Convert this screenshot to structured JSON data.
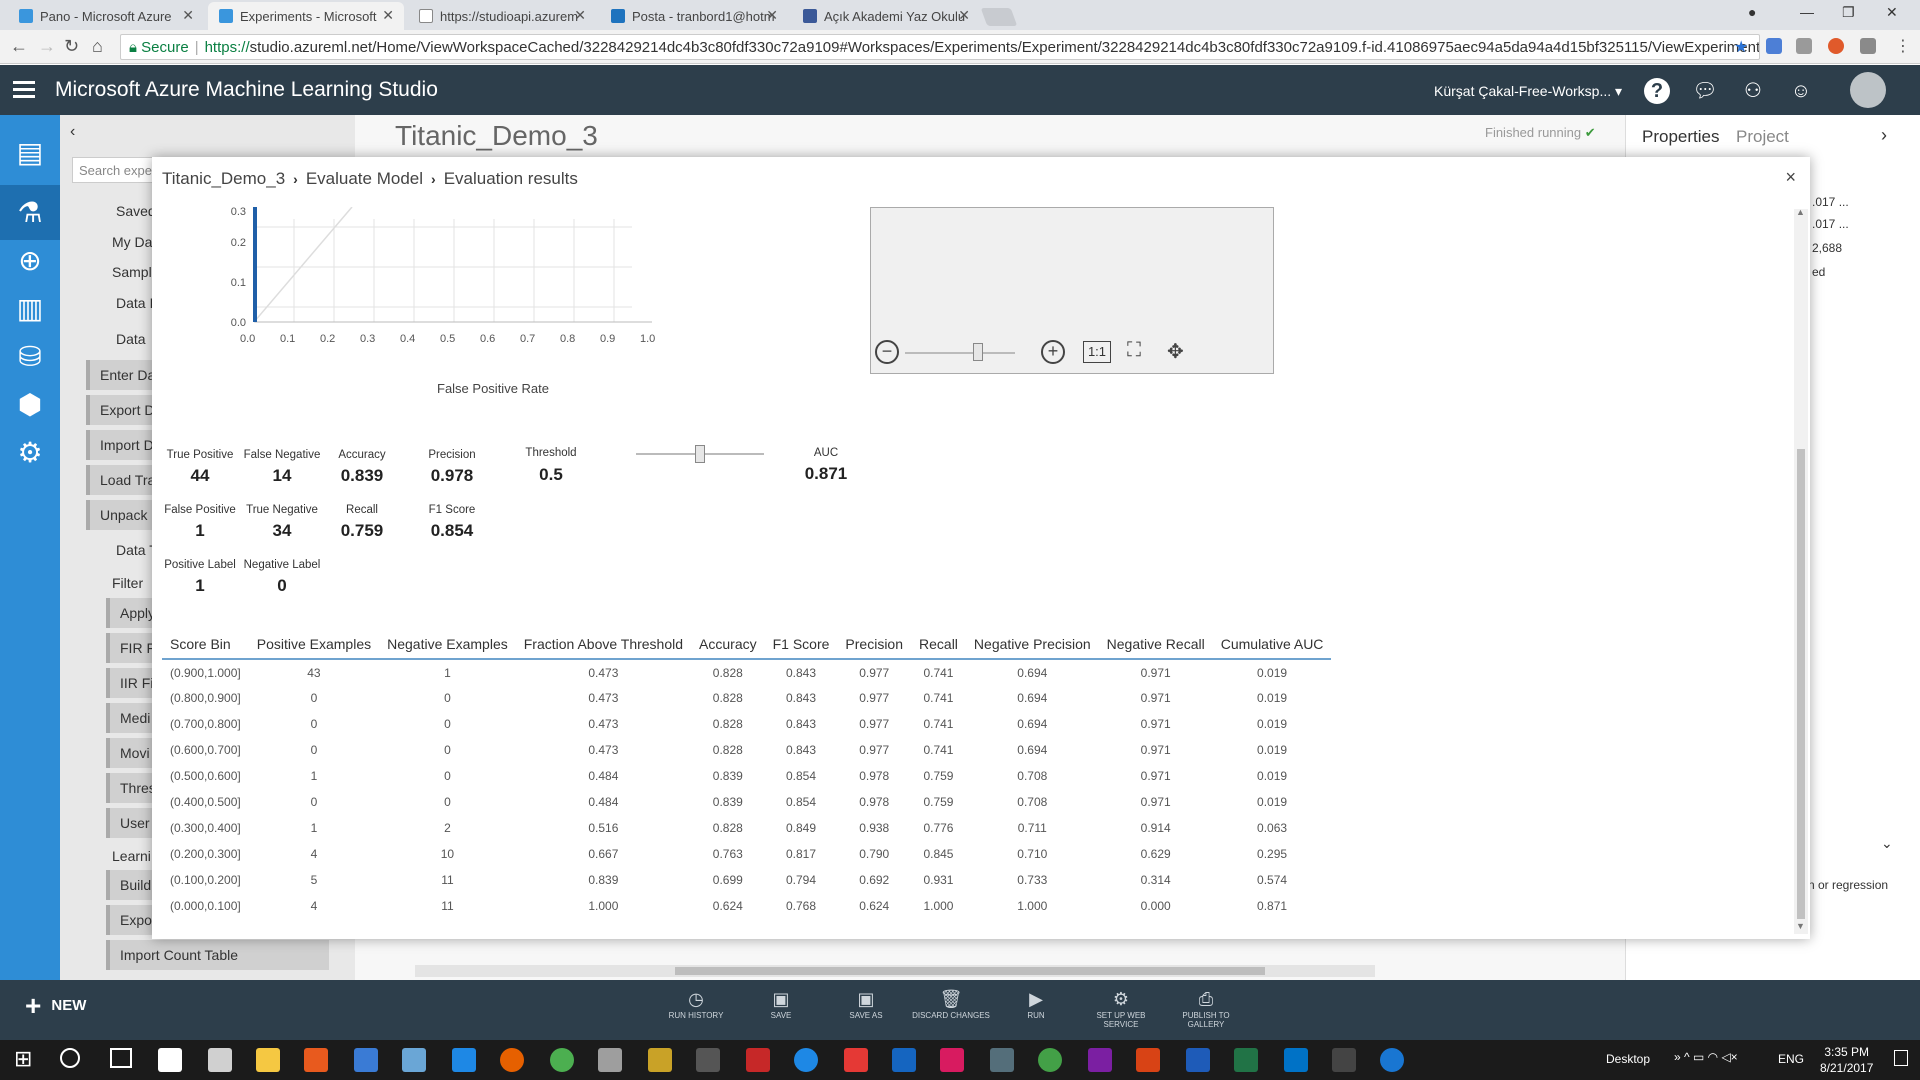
{
  "browser": {
    "tabs": [
      {
        "label": "Pano - Microsoft Azure",
        "color": "#3a96dd"
      },
      {
        "label": "Experiments - Microsoft",
        "color": "#3a96dd"
      },
      {
        "label": "https://studioapi.azurem",
        "color": "#888888"
      },
      {
        "label": "Posta - tranbord1@hotm",
        "color": "#1e73be"
      },
      {
        "label": "Açık Akademi Yaz Okulu",
        "color": "#3b5998"
      }
    ],
    "secure_label": "Secure",
    "url_scheme": "https://",
    "url_rest": "studio.azureml.net/Home/ViewWorkspaceCached/3228429214dc4b3c80fdf330c72a9109#Workspaces/Experiments/Experiment/3228429214dc4b3c80fdf330c72a9109.f-id.41086975aec94a5da94a4d15bf325115/ViewExperiment"
  },
  "app": {
    "title": "Microsoft Azure Machine Learning Studio",
    "workspace": "Kürşat Çakal-Free-Worksp...",
    "header_icons": [
      "help-icon",
      "chat-icon",
      "community-icon",
      "smiley-icon",
      "user-avatar-icon"
    ]
  },
  "background": {
    "experiment_title": "Titanic_Demo_3",
    "status": "Finished running",
    "right_tabs": [
      "Properties",
      "Project"
    ],
    "right_snippets": [
      ".017 ...",
      ".017 ...",
      "2,688",
      "ed",
      "n or regression"
    ],
    "palette": {
      "search_placeholder": "Search experi",
      "items": [
        "Saved",
        "My Da",
        "Sampl",
        "Data I",
        "Data",
        "Data T",
        "Filter",
        "Learni"
      ],
      "modules": [
        "Enter Da",
        "Export D",
        "Import D",
        "Load Tra",
        "Unpack",
        "Apply",
        "FIR Fi",
        "IIR Fi",
        "Medi",
        "Movi",
        "Thres",
        "User",
        "Build",
        "Expo",
        "Import Count Table"
      ]
    }
  },
  "modal": {
    "breadcrumb": [
      "Titanic_Demo_3",
      "Evaluate Model",
      "Evaluation results"
    ],
    "close_label": "×",
    "chart": {
      "y_ticks": [
        "0.0",
        "0.1",
        "0.2",
        "0.3"
      ],
      "x_ticks": [
        "0.0",
        "0.1",
        "0.2",
        "0.3",
        "0.4",
        "0.5",
        "0.6",
        "0.7",
        "0.8",
        "0.9",
        "1.0"
      ],
      "xlabel": "False Positive Rate"
    },
    "zoom_controls": {
      "zoom_out": "−",
      "zoom_in": "+",
      "one_to_one": "1:1"
    },
    "stats": {
      "true_positive": {
        "label": "True Positive",
        "value": "44"
      },
      "false_negative": {
        "label": "False Negative",
        "value": "14"
      },
      "accuracy": {
        "label": "Accuracy",
        "value": "0.839"
      },
      "precision": {
        "label": "Precision",
        "value": "0.978"
      },
      "threshold": {
        "label": "Threshold",
        "value": "0.5"
      },
      "auc": {
        "label": "AUC",
        "value": "0.871"
      },
      "false_positive": {
        "label": "False Positive",
        "value": "1"
      },
      "true_negative": {
        "label": "True Negative",
        "value": "34"
      },
      "recall": {
        "label": "Recall",
        "value": "0.759"
      },
      "f1_score": {
        "label": "F1 Score",
        "value": "0.854"
      },
      "positive_label": {
        "label": "Positive Label",
        "value": "1"
      },
      "negative_label": {
        "label": "Negative Label",
        "value": "0"
      }
    },
    "threshold_slider_value": 0.5,
    "table": {
      "headers": [
        "Score Bin",
        "Positive Examples",
        "Negative Examples",
        "Fraction Above Threshold",
        "Accuracy",
        "F1 Score",
        "Precision",
        "Recall",
        "Negative Precision",
        "Negative Recall",
        "Cumulative AUC"
      ],
      "rows": [
        [
          "(0.900,1.000]",
          "43",
          "1",
          "0.473",
          "0.828",
          "0.843",
          "0.977",
          "0.741",
          "0.694",
          "0.971",
          "0.019"
        ],
        [
          "(0.800,0.900]",
          "0",
          "0",
          "0.473",
          "0.828",
          "0.843",
          "0.977",
          "0.741",
          "0.694",
          "0.971",
          "0.019"
        ],
        [
          "(0.700,0.800]",
          "0",
          "0",
          "0.473",
          "0.828",
          "0.843",
          "0.977",
          "0.741",
          "0.694",
          "0.971",
          "0.019"
        ],
        [
          "(0.600,0.700]",
          "0",
          "0",
          "0.473",
          "0.828",
          "0.843",
          "0.977",
          "0.741",
          "0.694",
          "0.971",
          "0.019"
        ],
        [
          "(0.500,0.600]",
          "1",
          "0",
          "0.484",
          "0.839",
          "0.854",
          "0.978",
          "0.759",
          "0.708",
          "0.971",
          "0.019"
        ],
        [
          "(0.400,0.500]",
          "0",
          "0",
          "0.484",
          "0.839",
          "0.854",
          "0.978",
          "0.759",
          "0.708",
          "0.971",
          "0.019"
        ],
        [
          "(0.300,0.400]",
          "1",
          "2",
          "0.516",
          "0.828",
          "0.849",
          "0.938",
          "0.776",
          "0.711",
          "0.914",
          "0.063"
        ],
        [
          "(0.200,0.300]",
          "4",
          "10",
          "0.667",
          "0.763",
          "0.817",
          "0.790",
          "0.845",
          "0.710",
          "0.629",
          "0.295"
        ],
        [
          "(0.100,0.200]",
          "5",
          "11",
          "0.839",
          "0.699",
          "0.794",
          "0.692",
          "0.931",
          "0.733",
          "0.314",
          "0.574"
        ],
        [
          "(0.000,0.100]",
          "4",
          "11",
          "1.000",
          "0.624",
          "0.768",
          "0.624",
          "1.000",
          "1.000",
          "0.000",
          "0.871"
        ]
      ]
    }
  },
  "command_bar": {
    "new_label": "NEW",
    "commands": [
      "RUN HISTORY",
      "SAVE",
      "SAVE AS",
      "DISCARD CHANGES",
      "RUN",
      "SET UP WEB SERVICE",
      "PUBLISH TO GALLERY"
    ]
  },
  "taskbar": {
    "desktop_label": "Desktop",
    "language": "ENG",
    "time": "3:35 PM",
    "date": "8/21/2017"
  },
  "colors": {
    "header_bg": "#2d3e4b",
    "rail_bg": "#2e8dd6",
    "table_rule": "#6fa3cf",
    "roc_line": "#1f5fa8"
  }
}
